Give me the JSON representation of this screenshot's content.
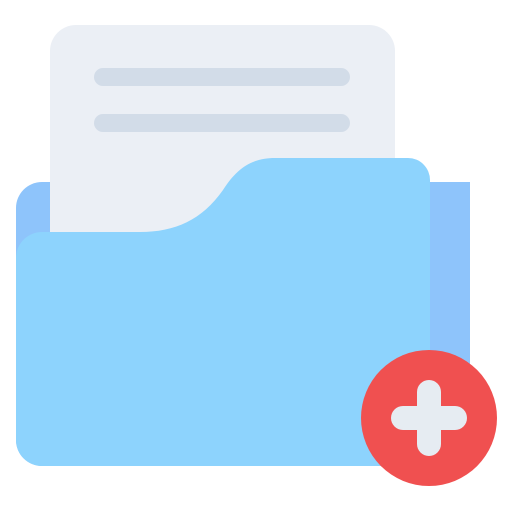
{
  "icon": {
    "name": "add-folder-icon",
    "parts": {
      "folder_back": "folder-back-icon",
      "document": "document-icon",
      "folder_front": "folder-front-icon",
      "add_badge": "add-badge-icon",
      "plus": "plus-icon"
    }
  },
  "colors": {
    "folder_back": "#8EC4FB",
    "folder_front": "#8DD3FD",
    "document": "#EBEFF5",
    "document_lines": "#D2DCE8",
    "badge": "#F05050",
    "plus": "#E6ECF2"
  }
}
